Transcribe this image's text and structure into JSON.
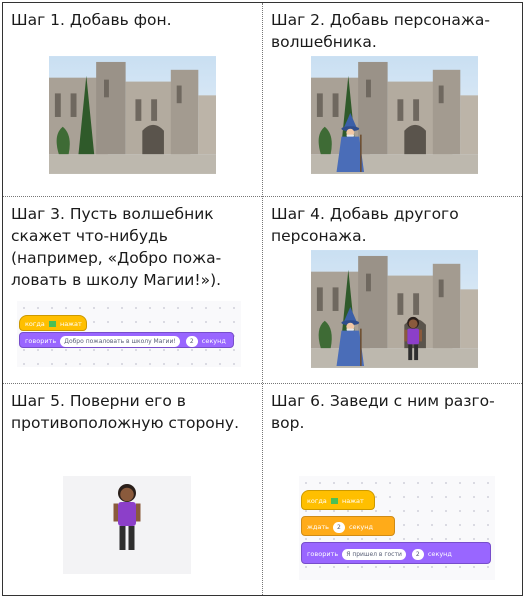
{
  "steps": [
    {
      "caption": "Шаг 1. Добавь фон."
    },
    {
      "caption": "Шаг 2. Добавь персонажа-\nволшебника."
    },
    {
      "caption": "Шаг 3. Пусть волшебник\nскажет что-нибудь\n(например, «Добро пожа-\nловать в школу Магии!»)."
    },
    {
      "caption": "Шаг 4. Добавь другого\nперсонажа."
    },
    {
      "caption": "Шаг 5. Поверни его в\nпротивоположную сторону."
    },
    {
      "caption": "Шаг 6. Заведи с ним разго-\nвор."
    }
  ],
  "script_step3": {
    "hat": {
      "when": "когда",
      "clicked": "нажат"
    },
    "say": {
      "label": "говорить",
      "text": "Добро пожаловать в школу Магии!",
      "secs": "2",
      "unit": "секунд"
    }
  },
  "script_step6": {
    "hat": {
      "when": "когда",
      "clicked": "нажат"
    },
    "wait": {
      "label": "ждать",
      "secs": "2",
      "unit": "секунд"
    },
    "say": {
      "label": "говорить",
      "text": "Я пришел в гости",
      "secs": "2",
      "unit": "секунд"
    }
  }
}
